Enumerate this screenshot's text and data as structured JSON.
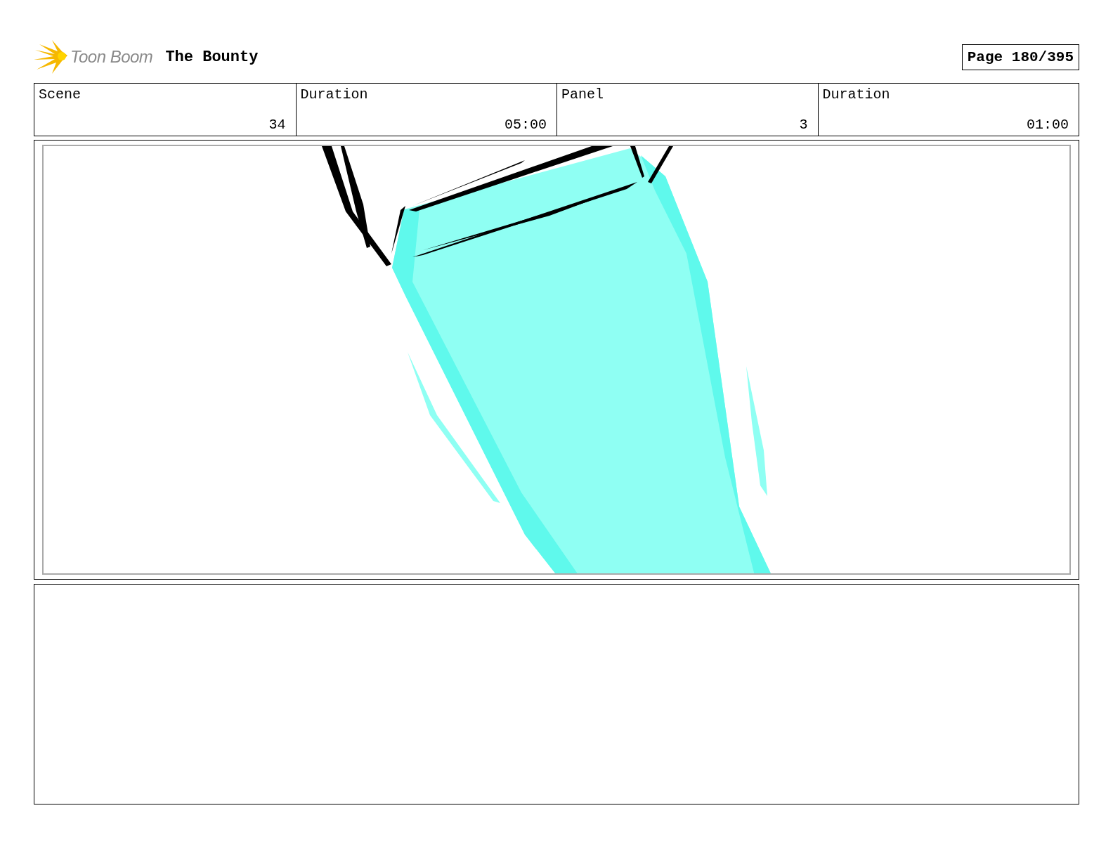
{
  "header": {
    "logo_text": "Toon Boom",
    "project_title": "The Bounty",
    "page": "Page 180/395"
  },
  "fields": [
    {
      "label": "Scene",
      "value": "34"
    },
    {
      "label": "Duration",
      "value": "05:00"
    },
    {
      "label": "Panel",
      "value": "3"
    },
    {
      "label": "Duration",
      "value": "01:00"
    }
  ]
}
